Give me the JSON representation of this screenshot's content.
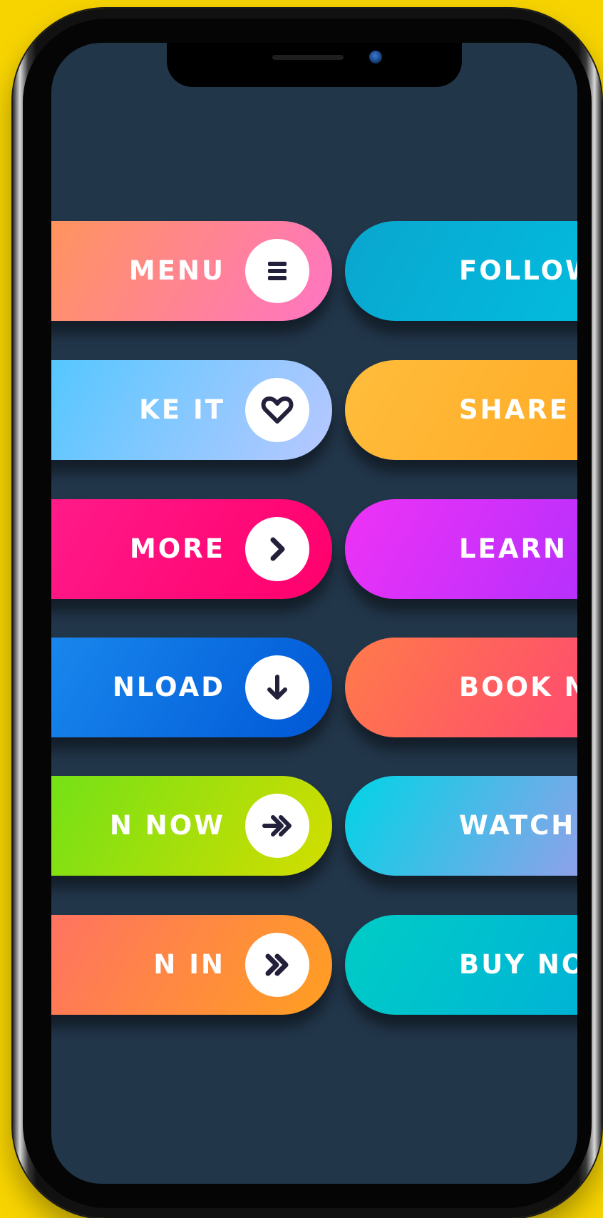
{
  "colors": {
    "background": "#f7d400",
    "screen": "#22364a",
    "icon_ink": "#22203a"
  },
  "buttons_left": [
    {
      "label": "MENU",
      "icon": "menu-icon",
      "gradient": [
        "#ff9a4d",
        "#ff74c4"
      ]
    },
    {
      "label": "KE IT",
      "icon": "heart-icon",
      "gradient": [
        "#45c7ff",
        "#b8c8ff"
      ]
    },
    {
      "label": "MORE",
      "icon": "chevron-right-icon",
      "gradient": [
        "#ff1f8e",
        "#ff006c"
      ]
    },
    {
      "label": "NLOAD",
      "icon": "arrow-down-icon",
      "gradient": [
        "#1d8ff0",
        "#0057d6"
      ]
    },
    {
      "label": "N NOW",
      "icon": "double-arrow-right-icon",
      "gradient": [
        "#64e21a",
        "#d4dd00"
      ]
    },
    {
      "label": "N IN",
      "icon": "double-chevron-right-icon",
      "gradient": [
        "#ff6c6c",
        "#ff9f20"
      ]
    }
  ],
  "buttons_right": [
    {
      "label": "FOLLOW",
      "gradient": [
        "#0aa6cf",
        "#00c2e3"
      ]
    },
    {
      "label": "SHARE",
      "gradient": [
        "#ffbd3c",
        "#ffa51f"
      ]
    },
    {
      "label": "LEARN MORE",
      "gradient": [
        "#ef32f6",
        "#a32fff"
      ]
    },
    {
      "label": "BOOK NOW",
      "gradient": [
        "#ff7b4a",
        "#ff3b7c"
      ]
    },
    {
      "label": "WATCH NOW",
      "gradient": [
        "#00d4e6",
        "#c18fea"
      ]
    },
    {
      "label": "BUY NOW",
      "gradient": [
        "#00cdc6",
        "#00aadb"
      ]
    }
  ]
}
